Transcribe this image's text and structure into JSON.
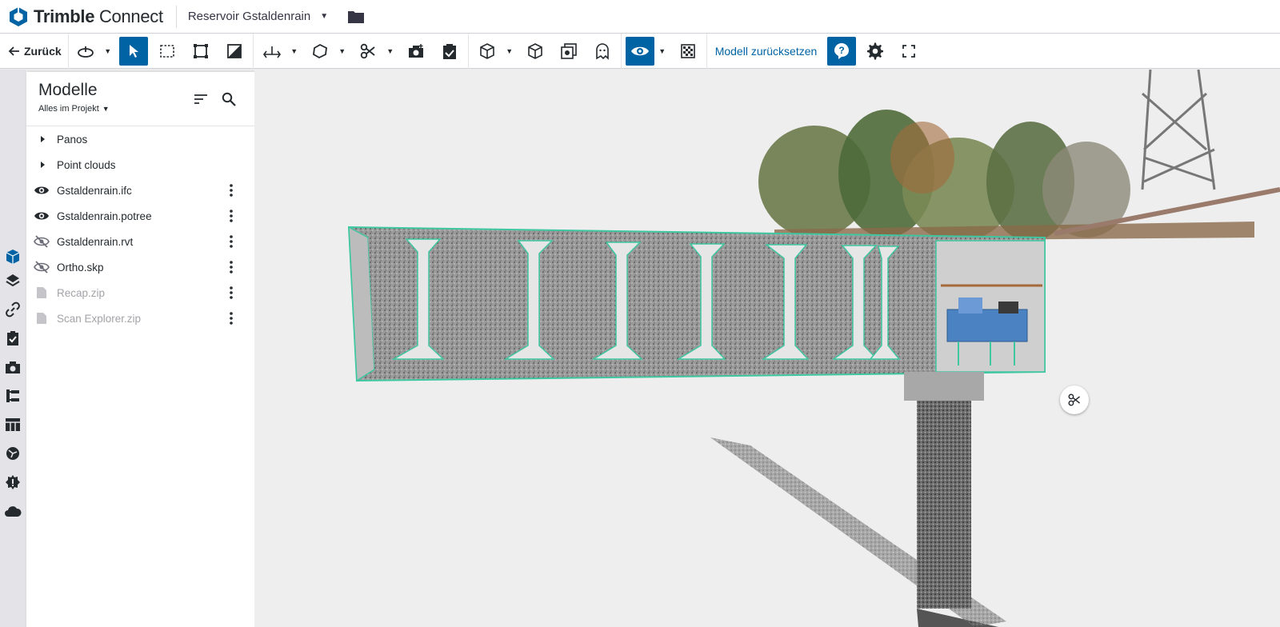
{
  "app": {
    "brand_prefix": "Trimble",
    "brand_suffix": "Connect",
    "project_name": "Reservoir Gstaldenrain"
  },
  "toolbar": {
    "back_label": "Zurück",
    "reset_label": "Modell zurücksetzen",
    "active_color": "#0063a3"
  },
  "panel": {
    "title": "Modelle",
    "scope": "Alles im Projekt",
    "folders": [
      {
        "label": "Panos"
      },
      {
        "label": "Point clouds"
      }
    ],
    "models": [
      {
        "label": "Gstaldenrain.ifc",
        "state": "visible",
        "icon": "eye-icon"
      },
      {
        "label": "Gstaldenrain.potree",
        "state": "visible",
        "icon": "eye-icon"
      },
      {
        "label": "Gstaldenrain.rvt",
        "state": "hidden",
        "icon": "eye-off-icon"
      },
      {
        "label": "Ortho.skp",
        "state": "hidden",
        "icon": "eye-off-icon"
      },
      {
        "label": "Recap.zip",
        "state": "unsupported",
        "icon": "file-icon"
      },
      {
        "label": "Scan Explorer.zip",
        "state": "unsupported",
        "icon": "file-icon"
      }
    ]
  },
  "rail": {
    "items": [
      "models-cube-icon",
      "layers-icon",
      "link-icon",
      "clipboard-check-icon",
      "camera-icon",
      "tree-structure-icon",
      "table-icon",
      "globe-icon",
      "settings-gear-icon",
      "cloud-icon"
    ],
    "active": "models-cube-icon"
  },
  "viewport": {
    "section_highlight_color": "#3ec7a0",
    "floating_tool": "scissors-icon"
  }
}
